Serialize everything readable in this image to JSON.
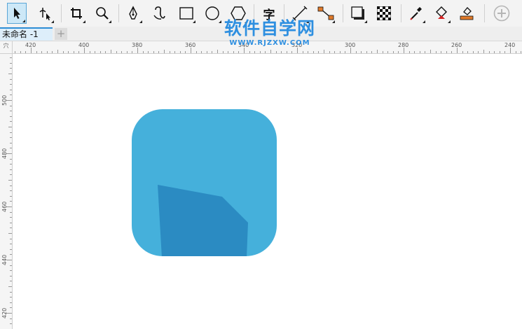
{
  "toolbar": {
    "tools": [
      {
        "name": "pick-tool",
        "icon": "arrow-pointer-icon",
        "active": true
      },
      {
        "name": "shape-tool",
        "icon": "shape-node-icon"
      },
      {
        "name": "crop-tool",
        "icon": "crop-icon"
      },
      {
        "name": "zoom-tool",
        "icon": "magnifier-icon"
      },
      {
        "name": "freehand-tool",
        "icon": "pen-nib-icon"
      },
      {
        "name": "artistic-media-tool",
        "icon": "curve-icon"
      },
      {
        "name": "rectangle-tool",
        "icon": "rectangle-icon"
      },
      {
        "name": "ellipse-tool",
        "icon": "ellipse-icon"
      },
      {
        "name": "polygon-tool",
        "icon": "polygon-icon"
      },
      {
        "name": "text-tool",
        "icon": "text-icon"
      },
      {
        "name": "dimension-tool",
        "icon": "dimension-line-icon"
      },
      {
        "name": "connector-tool",
        "icon": "connector-icon"
      },
      {
        "name": "drop-shadow-tool",
        "icon": "drop-shadow-icon"
      },
      {
        "name": "transparency-tool",
        "icon": "checkerboard-icon"
      },
      {
        "name": "eyedropper-tool",
        "icon": "eyedropper-icon"
      },
      {
        "name": "interactive-fill-tool",
        "icon": "paint-bucket-icon"
      },
      {
        "name": "smart-fill-tool",
        "icon": "smart-fill-icon"
      },
      {
        "name": "add-tool",
        "icon": "plus-circle-icon"
      }
    ],
    "text_tool_glyph": "字"
  },
  "tabs": {
    "document_tab": "未命名 -1",
    "add_tab": "+"
  },
  "watermark": {
    "title": "软件自学网",
    "url": "WWW.RJZXW.COM"
  },
  "rulers": {
    "unit_label": "穴",
    "horizontal_labels": [
      "420",
      "400",
      "380",
      "360",
      "340",
      "320",
      "300",
      "280",
      "260",
      "240"
    ],
    "vertical_labels": [
      "500",
      "480",
      "460",
      "440",
      "420"
    ]
  },
  "artwork": {
    "rounded_square_color": "#45b0db",
    "inner_shape_color": "#2b8bc2"
  },
  "colors": {
    "toolbar_bg": "#f3f3f3",
    "active_tool_border": "#5aa6d6",
    "tab_accent": "#2e8ed6",
    "watermark": "#2e8fe0"
  }
}
